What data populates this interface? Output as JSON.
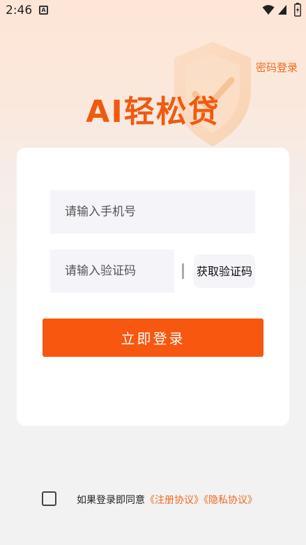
{
  "status_bar": {
    "time": "2:46",
    "app_icon_letter": "A",
    "icons": [
      "wifi-icon",
      "signal-icon",
      "battery-icon"
    ]
  },
  "header": {
    "password_login": "密码登录",
    "app_title": "AI轻松贷"
  },
  "form": {
    "phone_placeholder": "请输入手机号",
    "code_placeholder": "请输入验证码",
    "get_code_label": "获取验证码",
    "login_label": "立即登录"
  },
  "agreement": {
    "prefix": "如果登录即同意",
    "register_link": "《注册协议》",
    "privacy_link": "《隐私协议》"
  },
  "colors": {
    "accent": "#f7570f",
    "link": "#f06a1d",
    "input_bg": "#f5f4f9"
  }
}
